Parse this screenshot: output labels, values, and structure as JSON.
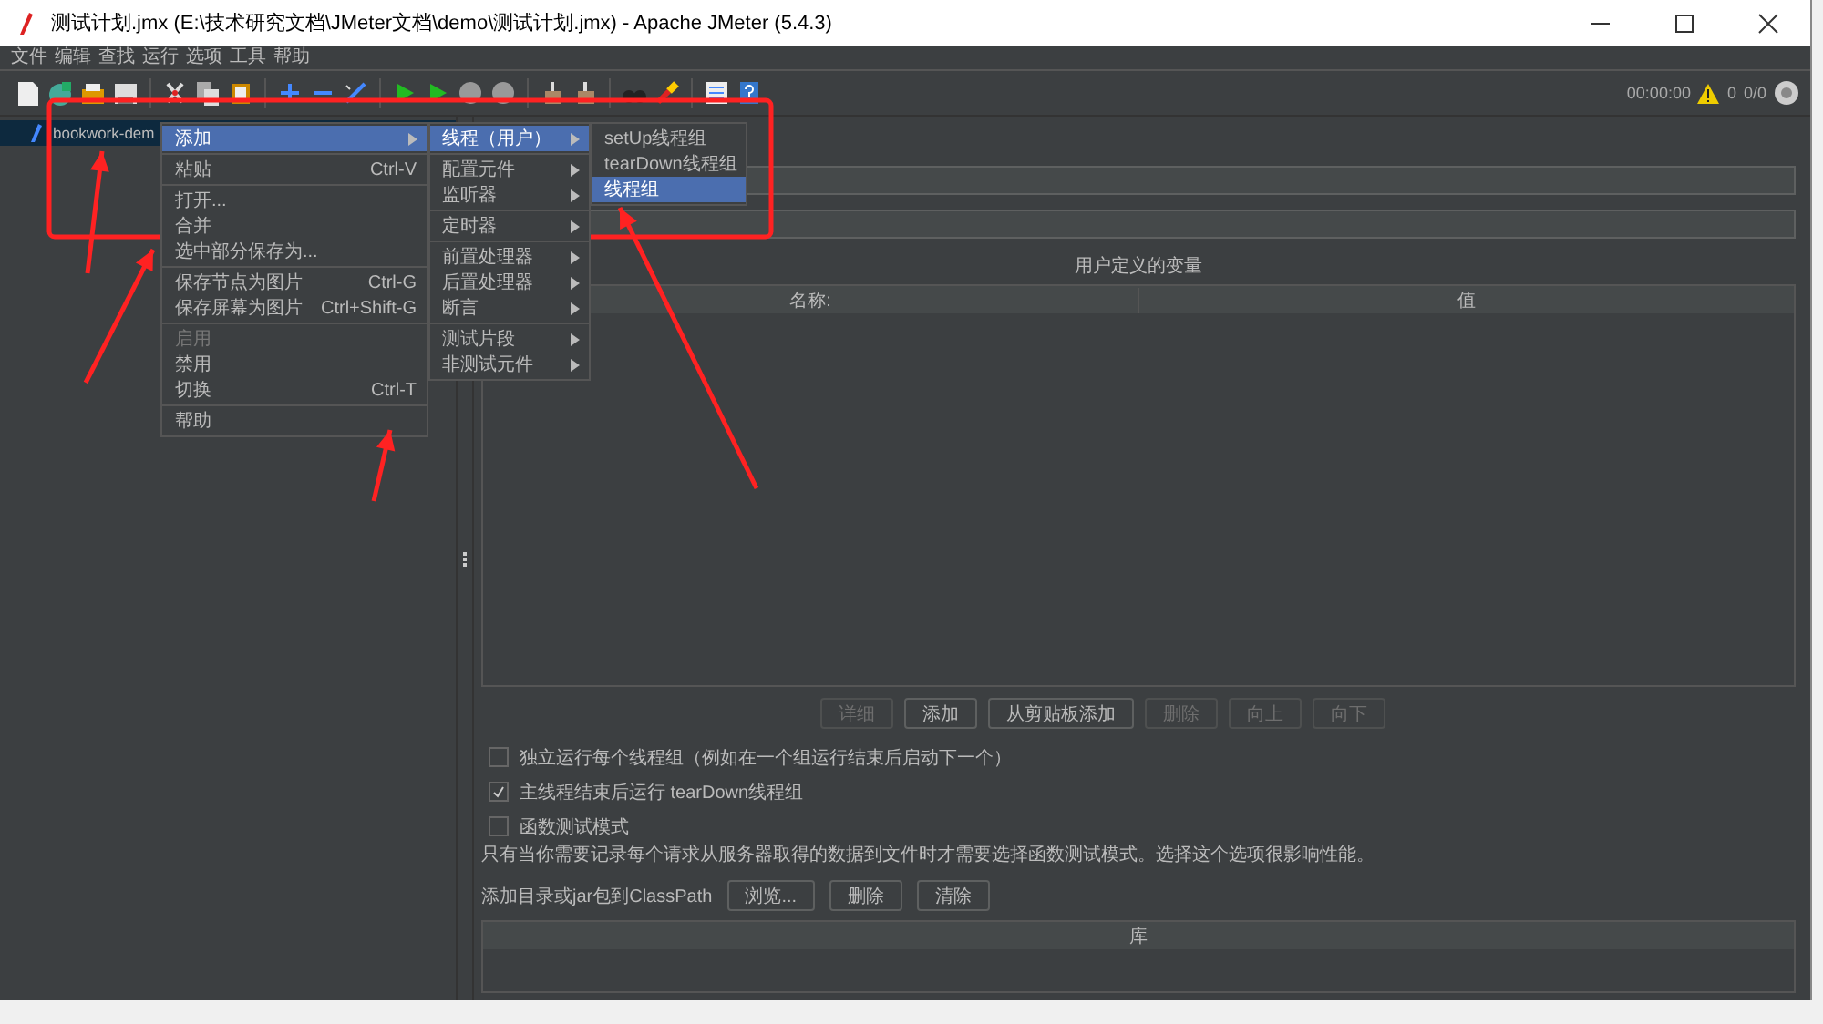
{
  "window": {
    "title": "测试计划.jmx (E:\\技术研究文档\\JMeter文档\\demo\\测试计划.jmx) - Apache JMeter (5.4.3)"
  },
  "menubar": [
    {
      "label": "文件"
    },
    {
      "label": "编辑"
    },
    {
      "label": "查找"
    },
    {
      "label": "运行"
    },
    {
      "label": "选项"
    },
    {
      "label": "工具"
    },
    {
      "label": "帮助"
    }
  ],
  "toolbar_status": {
    "elapsed": "00:00:00",
    "error_count": "0",
    "threads": "0/0"
  },
  "tree": [
    {
      "label": "bookwork-dem",
      "selected": true
    }
  ],
  "context_menu": [
    {
      "kind": "item",
      "label": "添加",
      "has_submenu": true,
      "selected": true,
      "disabled": false
    },
    {
      "kind": "separator"
    },
    {
      "kind": "item",
      "label": "粘贴",
      "shortcut": "Ctrl-V",
      "has_submenu": false,
      "selected": false,
      "disabled": false
    },
    {
      "kind": "separator"
    },
    {
      "kind": "item",
      "label": "打开...",
      "has_submenu": false,
      "selected": false,
      "disabled": false
    },
    {
      "kind": "item",
      "label": "合并",
      "has_submenu": false,
      "selected": false,
      "disabled": false
    },
    {
      "kind": "item",
      "label": "选中部分保存为...",
      "has_submenu": false,
      "selected": false,
      "disabled": false
    },
    {
      "kind": "separator"
    },
    {
      "kind": "item",
      "label": "保存节点为图片",
      "shortcut": "Ctrl-G",
      "has_submenu": false,
      "selected": false,
      "disabled": false
    },
    {
      "kind": "item",
      "label": "保存屏幕为图片",
      "shortcut": "Ctrl+Shift-G",
      "has_submenu": false,
      "selected": false,
      "disabled": false
    },
    {
      "kind": "separator"
    },
    {
      "kind": "item",
      "label": "启用",
      "has_submenu": false,
      "selected": false,
      "disabled": true
    },
    {
      "kind": "item",
      "label": "禁用",
      "has_submenu": false,
      "selected": false,
      "disabled": false
    },
    {
      "kind": "item",
      "label": "切换",
      "shortcut": "Ctrl-T",
      "has_submenu": false,
      "selected": false,
      "disabled": false
    },
    {
      "kind": "separator"
    },
    {
      "kind": "item",
      "label": "帮助",
      "has_submenu": false,
      "selected": false,
      "disabled": false
    }
  ],
  "add_submenu": [
    {
      "kind": "item",
      "label": "线程（用户）",
      "has_submenu": true,
      "selected": true,
      "disabled": false
    },
    {
      "kind": "separator"
    },
    {
      "kind": "item",
      "label": "配置元件",
      "has_submenu": true,
      "selected": false,
      "disabled": false
    },
    {
      "kind": "item",
      "label": "监听器",
      "has_submenu": true,
      "selected": false,
      "disabled": false
    },
    {
      "kind": "separator"
    },
    {
      "kind": "item",
      "label": "定时器",
      "has_submenu": true,
      "selected": false,
      "disabled": false
    },
    {
      "kind": "separator"
    },
    {
      "kind": "item",
      "label": "前置处理器",
      "has_submenu": true,
      "selected": false,
      "disabled": false
    },
    {
      "kind": "item",
      "label": "后置处理器",
      "has_submenu": true,
      "selected": false,
      "disabled": false
    },
    {
      "kind": "item",
      "label": "断言",
      "has_submenu": true,
      "selected": false,
      "disabled": false
    },
    {
      "kind": "separator"
    },
    {
      "kind": "item",
      "label": "测试片段",
      "has_submenu": true,
      "selected": false,
      "disabled": false
    },
    {
      "kind": "item",
      "label": "非测试元件",
      "has_submenu": true,
      "selected": false,
      "disabled": false
    }
  ],
  "thread_submenu": [
    {
      "kind": "item",
      "label": "setUp线程组",
      "has_submenu": false,
      "selected": false,
      "disabled": false
    },
    {
      "kind": "item",
      "label": "tearDown线程组",
      "has_submenu": false,
      "selected": false,
      "disabled": false
    },
    {
      "kind": "item",
      "label": "线程组",
      "has_submenu": false,
      "selected": true,
      "disabled": false
    }
  ],
  "variables": {
    "title": "用户定义的变量",
    "columns": [
      "名称:",
      "值"
    ],
    "buttons": [
      {
        "label": "详细",
        "disabled": true
      },
      {
        "label": "添加",
        "disabled": false
      },
      {
        "label": "从剪贴板添加",
        "disabled": false
      },
      {
        "label": "删除",
        "disabled": true
      },
      {
        "label": "向上",
        "disabled": true
      },
      {
        "label": "向下",
        "disabled": true
      }
    ]
  },
  "options": [
    {
      "label": "独立运行每个线程组（例如在一个组运行结束后启动下一个）",
      "checked": false
    },
    {
      "label": "主线程结束后运行 tearDown线程组",
      "checked": true
    },
    {
      "label": "函数测试模式",
      "checked": false
    }
  ],
  "note": "只有当你需要记录每个请求从服务器取得的数据到文件时才需要选择函数测试模式。选择这个选项很影响性能。",
  "classpath": {
    "label": "添加目录或jar包到ClassPath",
    "buttons": [
      {
        "label": "浏览...",
        "disabled": false
      },
      {
        "label": "删除",
        "disabled": false
      },
      {
        "label": "清除",
        "disabled": false
      }
    ],
    "columns": [
      "库"
    ]
  }
}
